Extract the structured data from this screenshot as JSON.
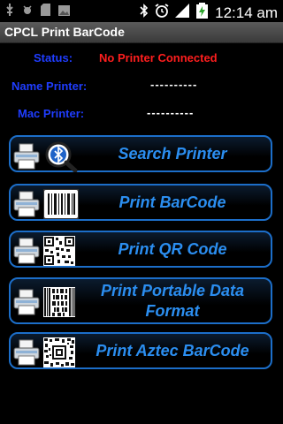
{
  "status_bar": {
    "time": "12:14 am",
    "icons": [
      "usb-icon",
      "debug-icon",
      "sdcard-icon",
      "image-icon",
      "bluetooth-icon",
      "alarm-icon",
      "signal-icon",
      "battery-icon"
    ]
  },
  "app": {
    "title": "CPCL Print BarCode"
  },
  "info": {
    "status_label": "Status:",
    "status_value": "No Printer Connected",
    "name_label": "Name Printer:",
    "name_value": "----------",
    "mac_label": "Mac Printer:",
    "mac_value": "----------"
  },
  "buttons": [
    {
      "label": "Search Printer",
      "icon": "bluetooth-search-icon"
    },
    {
      "label": "Print BarCode",
      "icon": "barcode-icon"
    },
    {
      "label": "Print QR Code",
      "icon": "qr-code-icon"
    },
    {
      "label": "Print Portable Data Format",
      "icon": "pdf417-icon"
    },
    {
      "label": "Print Aztec BarCode",
      "icon": "aztec-code-icon"
    }
  ],
  "colors": {
    "accent": "#2b8ef0",
    "label_blue": "#1f3dff",
    "error": "#ff1e1e",
    "border": "#1c6ec9"
  }
}
